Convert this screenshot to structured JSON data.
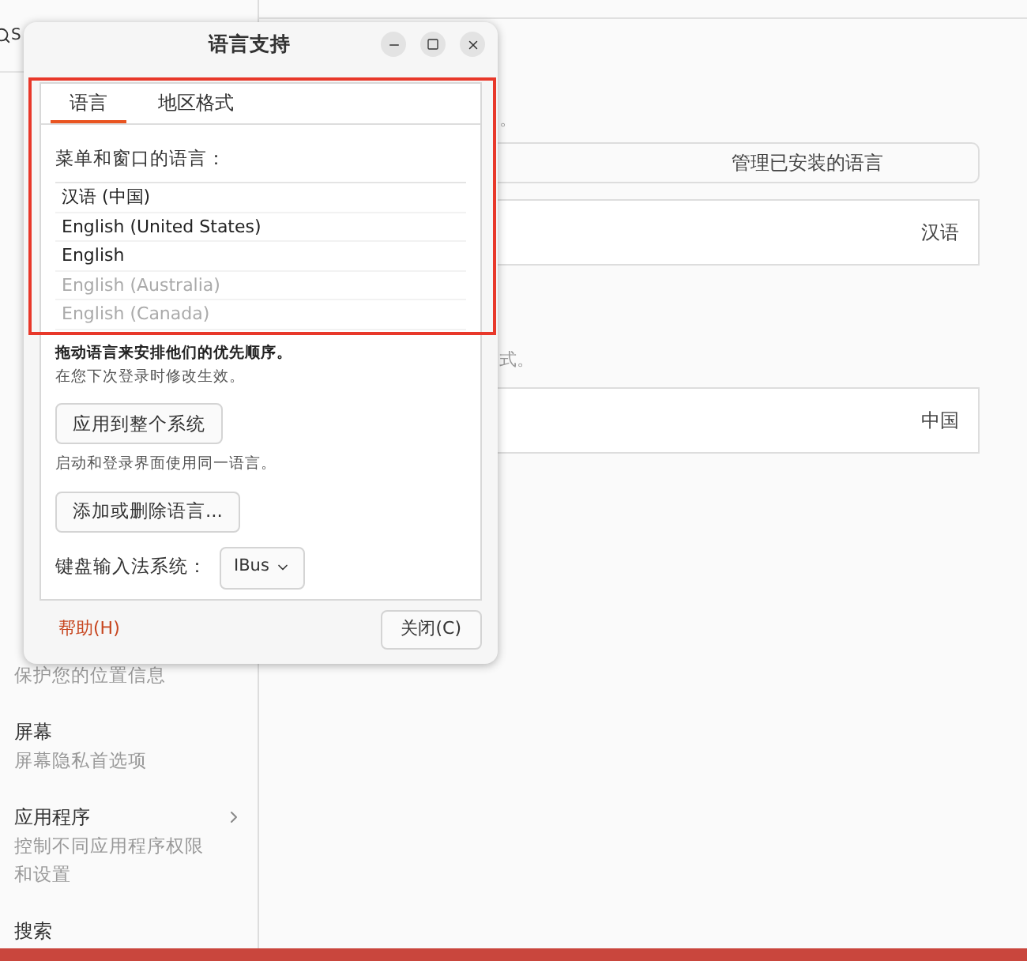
{
  "background": {
    "search": {
      "placeholder": "S"
    },
    "sidebar": {
      "items": [
        {
          "subtitle": "保护您的位置信息",
          "chevron": false
        },
        {
          "title": "屏幕",
          "subtitle": "屏幕隐私首选项",
          "chevron": false
        },
        {
          "title": "应用程序",
          "subtitle": "控制不同应用程序权限和设置",
          "chevron": true
        },
        {
          "title": "搜索",
          "chevron": false
        }
      ]
    },
    "main": {
      "note_1": "。",
      "manage_button": "管理已安装的语言",
      "language_value": "汉语",
      "note_2": "式。",
      "region_value": "中国"
    }
  },
  "dialog": {
    "title": "语言支持",
    "tabs": [
      {
        "label": "语言",
        "selected": true
      },
      {
        "label": "地区格式",
        "selected": false
      }
    ],
    "list_label": "菜单和窗口的语言：",
    "languages": [
      {
        "name": "汉语 (中国)",
        "dimmed": false
      },
      {
        "name": "English (United States)",
        "dimmed": false
      },
      {
        "name": "English",
        "dimmed": false
      },
      {
        "name": "English (Australia)",
        "dimmed": true
      },
      {
        "name": "English (Canada)",
        "dimmed": true
      }
    ],
    "hint_bold": "拖动语言来安排他们的优先顺序。",
    "hint": "在您下次登录时修改生效。",
    "apply_button": "应用到整个系统",
    "apply_hint": "启动和登录界面使用同一语言。",
    "add_button": "添加或删除语言...",
    "input_label": "键盘输入法系统：",
    "input_method": "IBus",
    "help_link": "帮助(H)",
    "close_button": "关闭(C)"
  }
}
